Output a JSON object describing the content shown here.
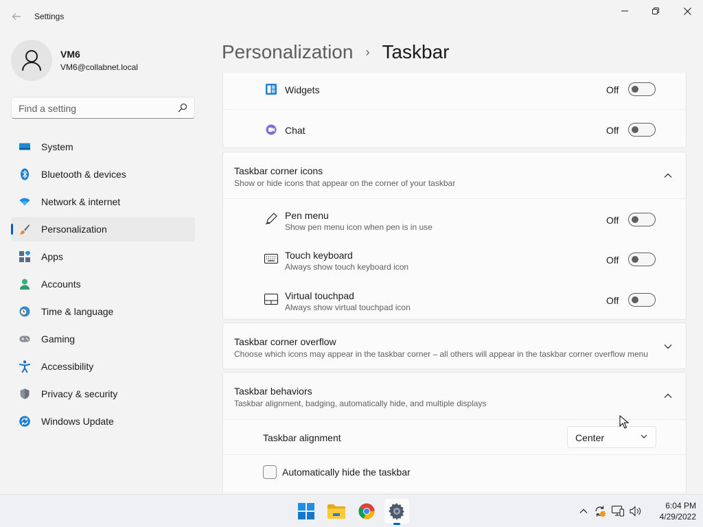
{
  "window": {
    "title": "Settings"
  },
  "profile": {
    "name": "VM6",
    "email": "VM6@collabnet.local"
  },
  "search": {
    "placeholder": "Find a setting"
  },
  "sidebar": {
    "items": [
      {
        "label": "System",
        "icon": "system-icon"
      },
      {
        "label": "Bluetooth & devices",
        "icon": "bluetooth-icon"
      },
      {
        "label": "Network & internet",
        "icon": "wifi-icon"
      },
      {
        "label": "Personalization",
        "icon": "paintbrush-icon",
        "active": true
      },
      {
        "label": "Apps",
        "icon": "apps-icon"
      },
      {
        "label": "Accounts",
        "icon": "accounts-icon"
      },
      {
        "label": "Time & language",
        "icon": "clock-globe-icon"
      },
      {
        "label": "Gaming",
        "icon": "gamepad-icon"
      },
      {
        "label": "Accessibility",
        "icon": "accessibility-icon"
      },
      {
        "label": "Privacy & security",
        "icon": "shield-icon"
      },
      {
        "label": "Windows Update",
        "icon": "update-icon"
      }
    ]
  },
  "breadcrumb": {
    "parent": "Personalization",
    "separator": "›",
    "current": "Taskbar"
  },
  "taskbar_items": {
    "widgets": {
      "label": "Widgets",
      "state": "Off",
      "icon": "widgets-icon"
    },
    "chat": {
      "label": "Chat",
      "state": "Off",
      "icon": "chat-icon"
    }
  },
  "corner_icons": {
    "title": "Taskbar corner icons",
    "subtitle": "Show or hide icons that appear on the corner of your taskbar",
    "expanded": true,
    "items": [
      {
        "label": "Pen menu",
        "sublabel": "Show pen menu icon when pen is in use",
        "state": "Off",
        "icon": "pen-icon"
      },
      {
        "label": "Touch keyboard",
        "sublabel": "Always show touch keyboard icon",
        "state": "Off",
        "icon": "keyboard-icon"
      },
      {
        "label": "Virtual touchpad",
        "sublabel": "Always show virtual touchpad icon",
        "state": "Off",
        "icon": "touchpad-icon"
      }
    ]
  },
  "corner_overflow": {
    "title": "Taskbar corner overflow",
    "subtitle": "Choose which icons may appear in the taskbar corner – all others will appear in the taskbar corner overflow menu",
    "expanded": false
  },
  "behaviors": {
    "title": "Taskbar behaviors",
    "subtitle": "Taskbar alignment, badging, automatically hide, and multiple displays",
    "expanded": true,
    "alignment_label": "Taskbar alignment",
    "alignment_value": "Center",
    "autohide_label": "Automatically hide the taskbar",
    "autohide_checked": false
  },
  "system_taskbar": {
    "apps": [
      "start-icon",
      "file-explorer-icon",
      "chrome-icon",
      "settings-icon"
    ],
    "time": "6:04 PM",
    "date": "4/29/2022"
  },
  "colors": {
    "accent": "#005fb8",
    "background": "#f3f3f3",
    "card": "#fbfbfb"
  }
}
